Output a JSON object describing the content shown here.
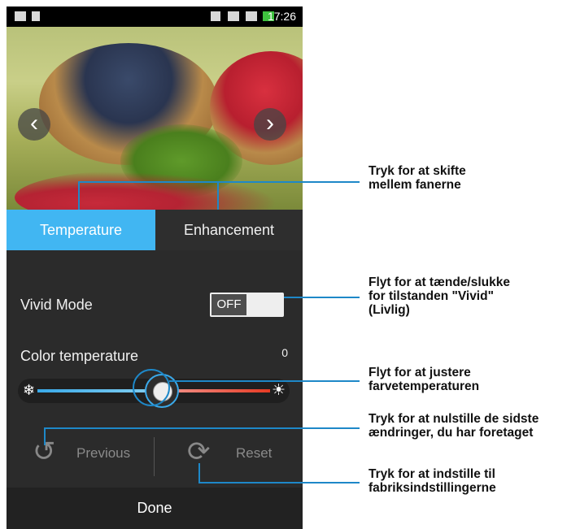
{
  "status_bar": {
    "time": "17:26"
  },
  "photo": {
    "prev_icon": "chevron-left-icon",
    "next_icon": "chevron-right-icon"
  },
  "tabs": [
    {
      "label": "Temperature",
      "active": true
    },
    {
      "label": "Enhancement",
      "active": false
    }
  ],
  "vivid": {
    "label": "Vivid Mode",
    "state": "OFF"
  },
  "color_temperature": {
    "label": "Color temperature",
    "value": "0",
    "level": 0.5
  },
  "actions": {
    "previous": {
      "label": "Previous",
      "icon": "undo-icon"
    },
    "reset": {
      "label": "Reset",
      "icon": "refresh-icon"
    }
  },
  "done_label": "Done",
  "callouts": [
    {
      "lines": [
        "Tryk for at skifte",
        "mellem fanerne"
      ]
    },
    {
      "lines": [
        "Flyt for at tænde/slukke",
        "for tilstanden \"Vivid\"",
        "(Livlig)"
      ]
    },
    {
      "lines": [
        "Flyt for at justere",
        "farvetemperaturen"
      ]
    },
    {
      "lines": [
        "Tryk for at nulstille de sidste",
        "ændringer, du har foretaget"
      ]
    },
    {
      "lines": [
        "Tryk for at indstille til",
        "fabriksindstillingerne"
      ]
    }
  ],
  "colors": {
    "accent": "#41b6f2",
    "callout_line": "#1e88c8",
    "background": "#2b2b2b"
  }
}
